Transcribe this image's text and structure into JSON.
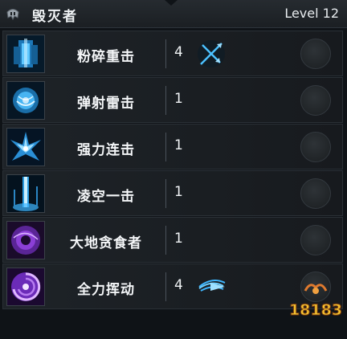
{
  "header": {
    "class_title": "毁灭者",
    "level": "Level 12"
  },
  "skills": [
    {
      "name": "粉碎重击",
      "level": "4",
      "has_rune": true,
      "rune": "crossed-arrows-icon",
      "icon": "crystal-wall-icon"
    },
    {
      "name": "弹射雷击",
      "level": "1",
      "has_rune": false,
      "icon": "lightning-ball-icon"
    },
    {
      "name": "强力连击",
      "level": "1",
      "has_rune": false,
      "icon": "ice-burst-icon"
    },
    {
      "name": "凌空一击",
      "level": "1",
      "has_rune": false,
      "icon": "sky-strike-icon"
    },
    {
      "name": "大地贪食者",
      "level": "1",
      "has_rune": false,
      "icon": "earth-vortex-icon"
    },
    {
      "name": "全力挥动",
      "level": "4",
      "has_rune": true,
      "rune": "blade-swing-icon",
      "icon": "purple-vortex-icon"
    }
  ],
  "colors": {
    "ice_blue": "#3fb6ff",
    "purple": "#8b3fd6"
  },
  "watermark": {
    "text": "18183"
  }
}
